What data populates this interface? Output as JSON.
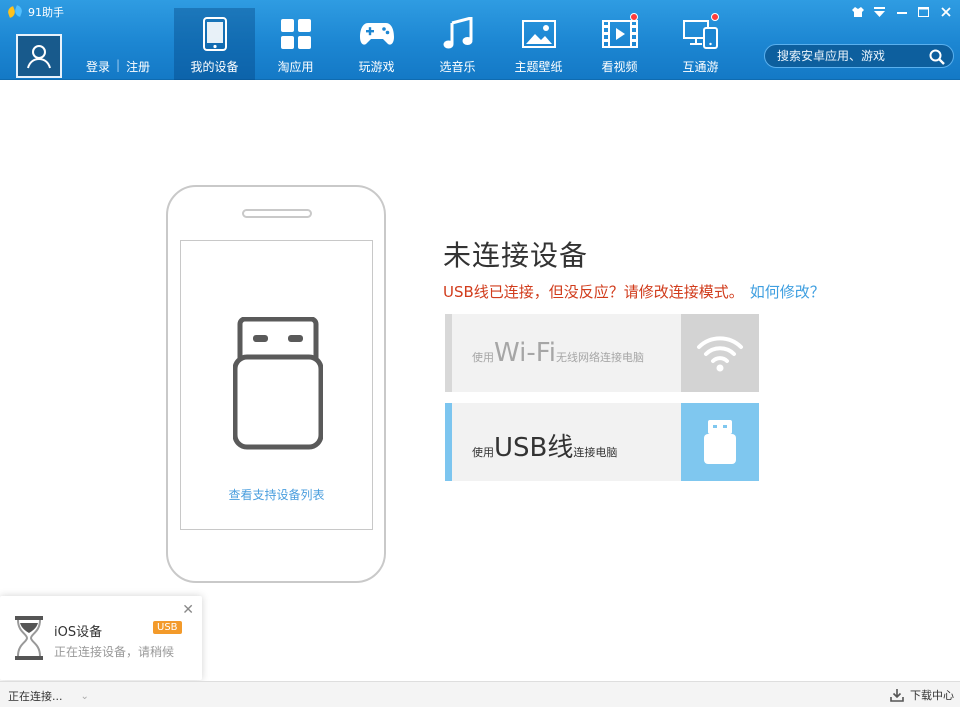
{
  "app": {
    "title": "91助手"
  },
  "user": {
    "login": "登录",
    "register": "注册"
  },
  "nav": [
    {
      "label": "我的设备",
      "icon": "phone-icon",
      "active": true,
      "dot": false
    },
    {
      "label": "淘应用",
      "icon": "apps-grid-icon",
      "active": false,
      "dot": false
    },
    {
      "label": "玩游戏",
      "icon": "gamepad-icon",
      "active": false,
      "dot": false
    },
    {
      "label": "选音乐",
      "icon": "music-note-icon",
      "active": false,
      "dot": false
    },
    {
      "label": "主题壁纸",
      "icon": "picture-icon",
      "active": false,
      "dot": false
    },
    {
      "label": "看视频",
      "icon": "film-icon",
      "active": false,
      "dot": true
    },
    {
      "label": "互通游",
      "icon": "multi-device-icon",
      "active": false,
      "dot": true
    }
  ],
  "search": {
    "placeholder": "搜索安卓应用、游戏"
  },
  "device": {
    "support_link": "查看支持设备列表"
  },
  "status": {
    "title": "未连接设备",
    "message": "USB线已连接，但没反应？请修改连接模式。",
    "howto": "如何修改？"
  },
  "options": {
    "wifi": {
      "pre": "使用",
      "big": "Wi-Fi",
      "post": "无线网络连接电脑"
    },
    "usb": {
      "pre": "使用",
      "big": "USB线",
      "post": "连接电脑"
    }
  },
  "toast": {
    "title": "iOS设备",
    "badge": "USB",
    "subtitle": "正在连接设备，请稍候"
  },
  "statusbar": {
    "left": "正在连接...",
    "download": "下载中心"
  },
  "colors": {
    "header": "#1c86d2",
    "accent": "#7fc7ef",
    "warning": "#d13c1c",
    "link": "#3f9fe0",
    "badge": "#f39a2a"
  }
}
